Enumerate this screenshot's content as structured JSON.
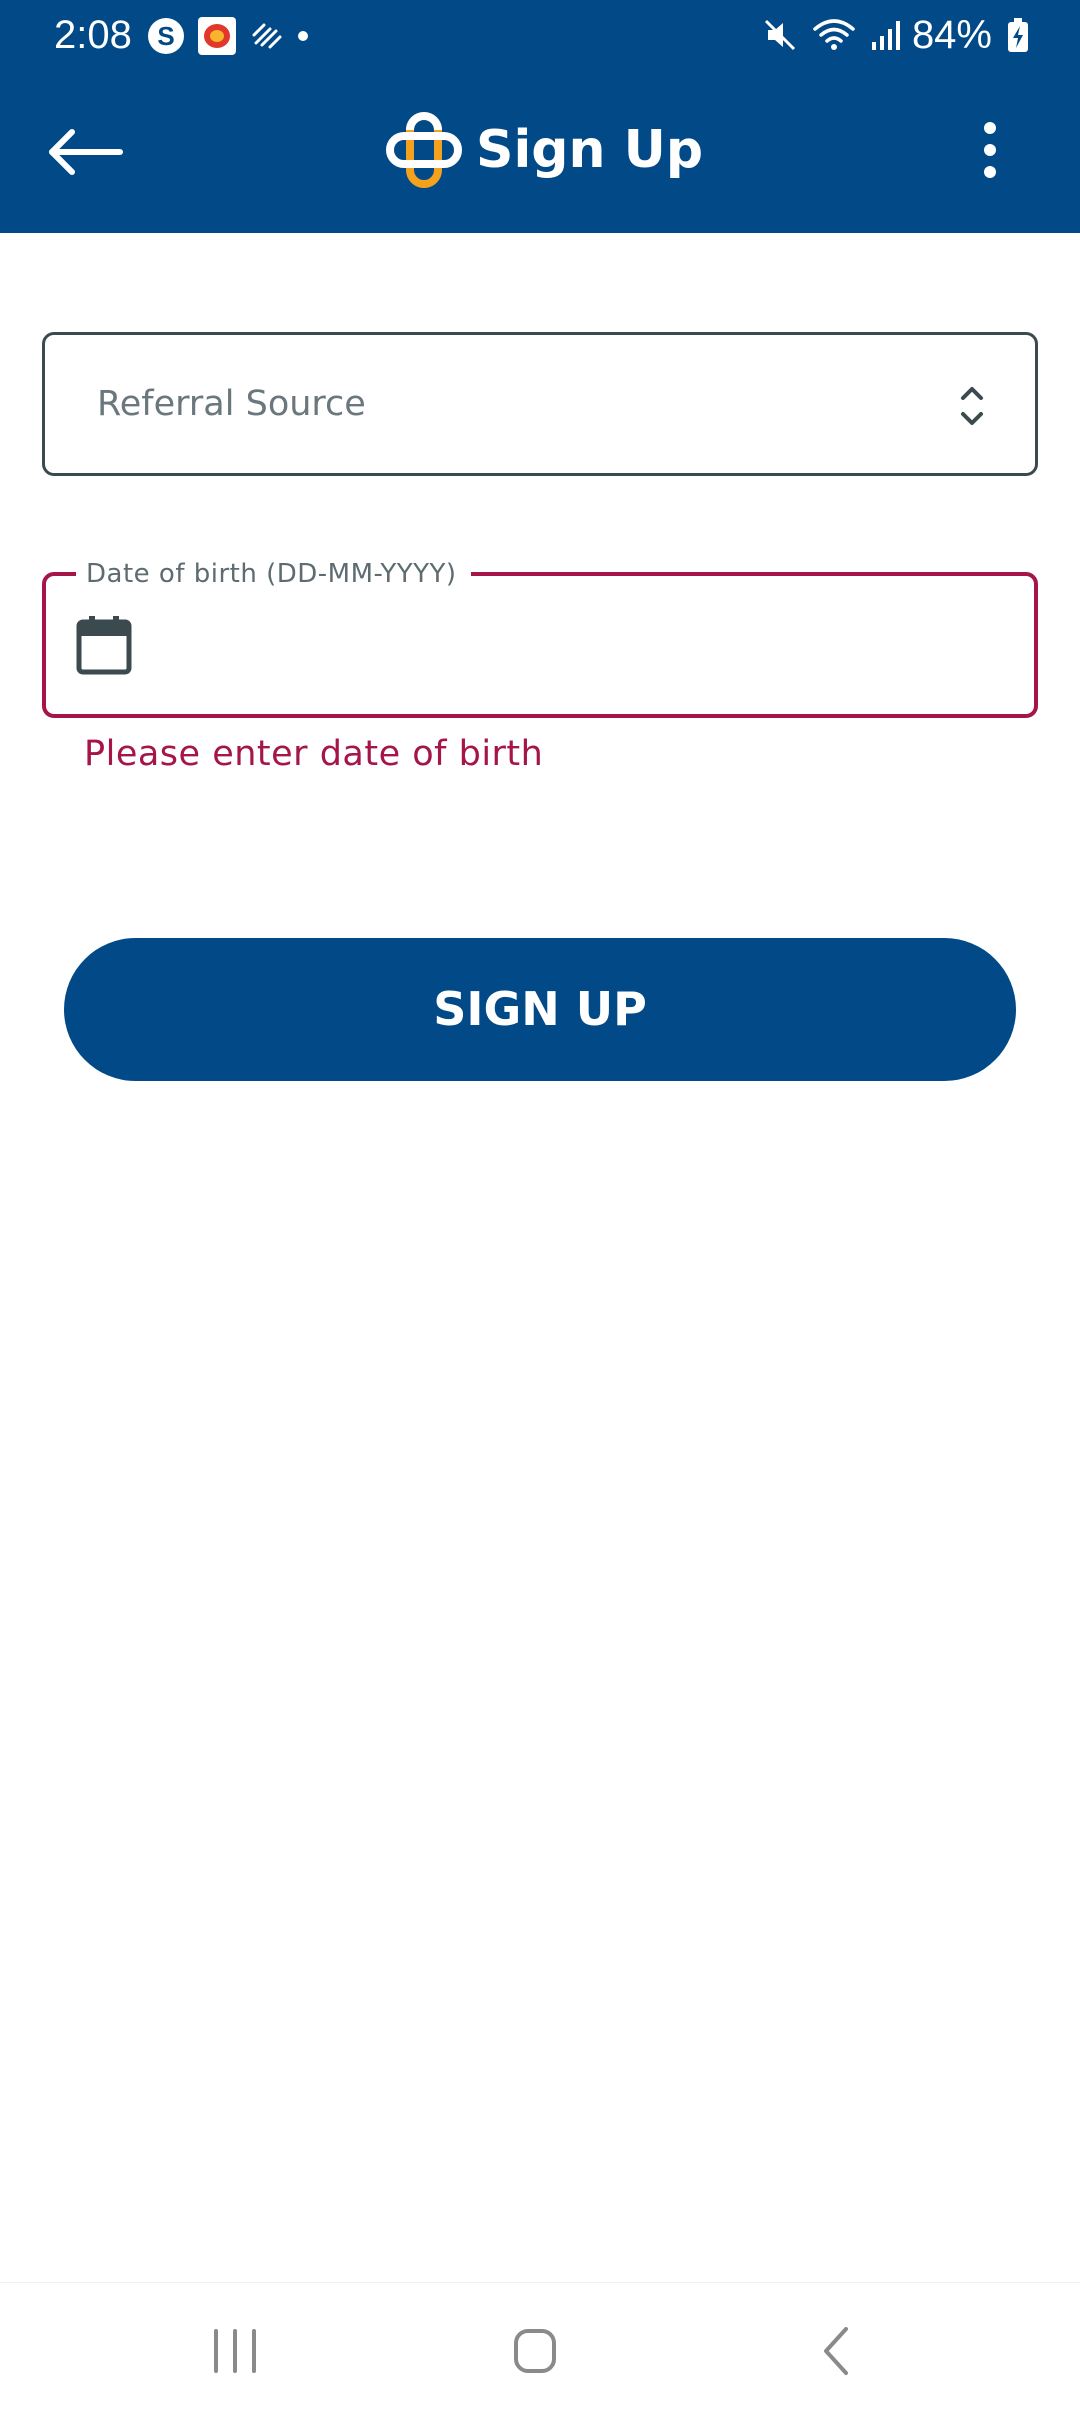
{
  "status_bar": {
    "time": "2:08",
    "skype_letter": "S",
    "battery": "84%",
    "icons": [
      "skype-icon",
      "app-notification-icon",
      "stripes-icon",
      "dot-icon",
      "mute-icon",
      "wifi-icon",
      "signal-icon",
      "battery-charging-icon"
    ]
  },
  "app_bar": {
    "back_icon": "arrow-left-icon",
    "logo_icon": "cross-logo-icon",
    "title": "Sign Up",
    "more_icon": "more-vertical-icon"
  },
  "form": {
    "referral_select": {
      "placeholder": "Referral Source",
      "value": "",
      "icon": "unfold-icon"
    },
    "dob_field": {
      "label": "Date of birth (DD-MM-YYYY)",
      "value": "",
      "icon": "calendar-icon",
      "error": "Please enter date of birth"
    },
    "submit_label": "SIGN UP"
  },
  "nav_bar": {
    "icons": [
      "recents-icon",
      "home-icon",
      "back-icon"
    ]
  },
  "colors": {
    "primary": "#024a87",
    "accent_orange": "#f4a11d",
    "error": "#a5154a",
    "border": "#3b4a4f",
    "placeholder": "#6a787d"
  }
}
